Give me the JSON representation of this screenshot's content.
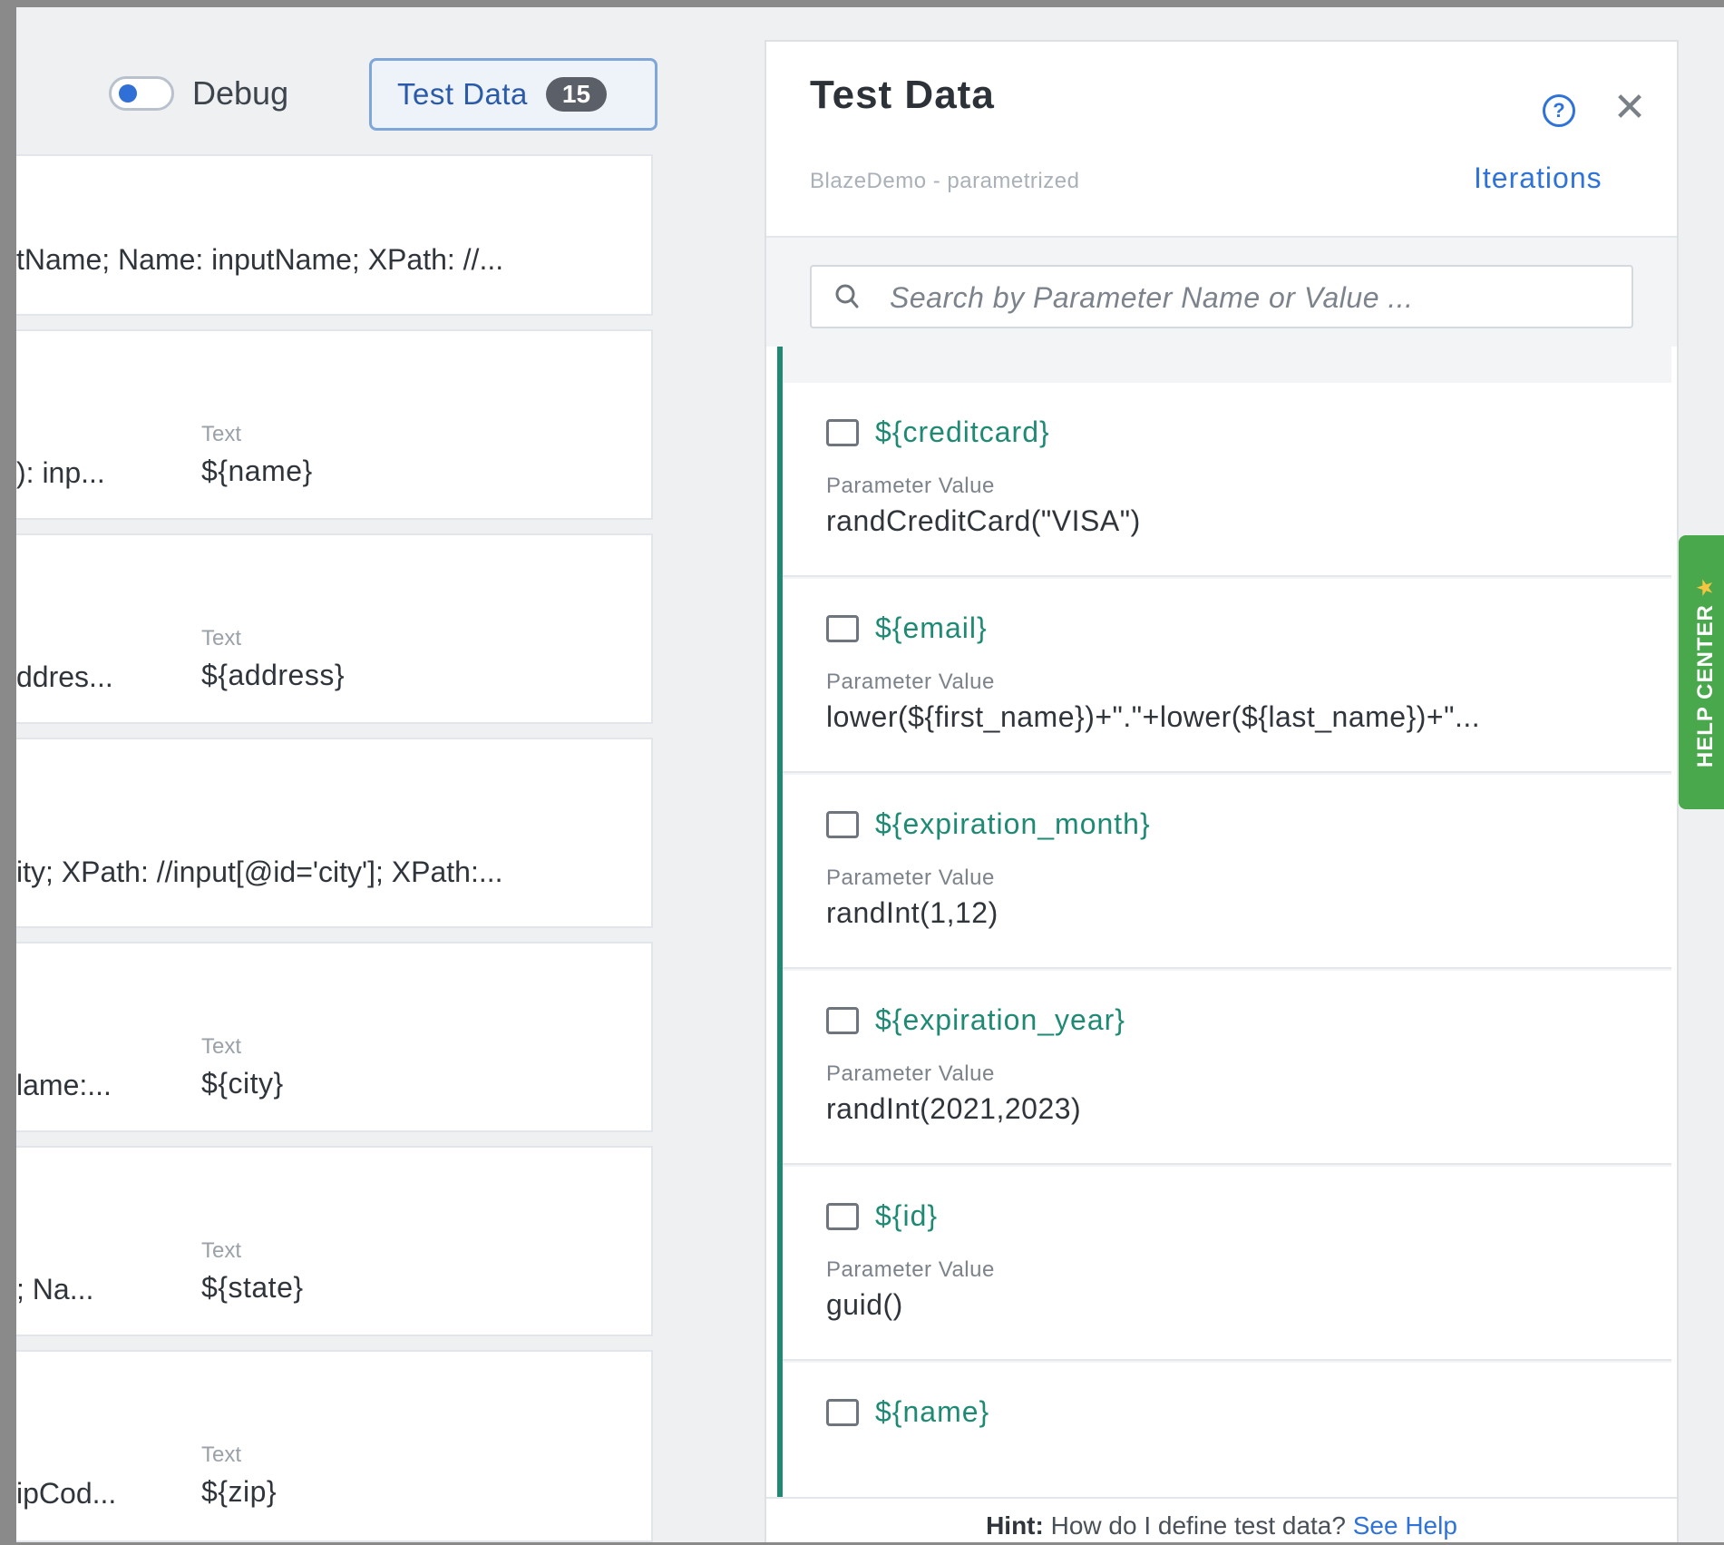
{
  "toolbar": {
    "debug_label": "Debug",
    "test_data_label": "Test Data",
    "test_data_count": "15"
  },
  "steps": [
    {
      "locator": "tName; Name: inputName; XPath: //..."
    },
    {
      "locator": "): inp...",
      "field_label": "Text",
      "field_value": "${name}"
    },
    {
      "locator": "ddres...",
      "field_label": "Text",
      "field_value": "${address}"
    },
    {
      "locator": "ity; XPath: //input[@id='city']; XPath:..."
    },
    {
      "locator": "lame:...",
      "field_label": "Text",
      "field_value": "${city}"
    },
    {
      "locator": "; Na...",
      "field_label": "Text",
      "field_value": "${state}"
    },
    {
      "locator": "ipCod...",
      "field_label": "Text",
      "field_value": "${zip}"
    }
  ],
  "panel": {
    "title": "Test Data",
    "subtitle": "BlazeDemo - parametrized",
    "iterations_label": "Iterations",
    "help_glyph": "?",
    "close_glyph": "✕",
    "search": {
      "placeholder": "Search by Parameter Name or Value ...",
      "value": ""
    },
    "parameters": [
      {
        "name": "${creditcard}",
        "value_label": "Parameter Value",
        "value": "randCreditCard(\"VISA\")"
      },
      {
        "name": "${email}",
        "value_label": "Parameter Value",
        "value": "lower(${first_name})+\".\"+lower(${last_name})+\"..."
      },
      {
        "name": "${expiration_month}",
        "value_label": "Parameter Value",
        "value": "randInt(1,12)"
      },
      {
        "name": "${expiration_year}",
        "value_label": "Parameter Value",
        "value": "randInt(2021,2023)"
      },
      {
        "name": "${id}",
        "value_label": "Parameter Value",
        "value": "guid()"
      },
      {
        "name": "${name}",
        "value_label": "",
        "value": ""
      }
    ],
    "hint": {
      "prefix": "Hint:",
      "text": " How do I define test data? ",
      "link": "See Help"
    }
  },
  "help_center": {
    "label": "HELP CENTER",
    "star": "★"
  },
  "colors": {
    "accent_green": "#1f8a74",
    "link_blue": "#2f73d9",
    "help_tab_green": "#49a84c"
  }
}
